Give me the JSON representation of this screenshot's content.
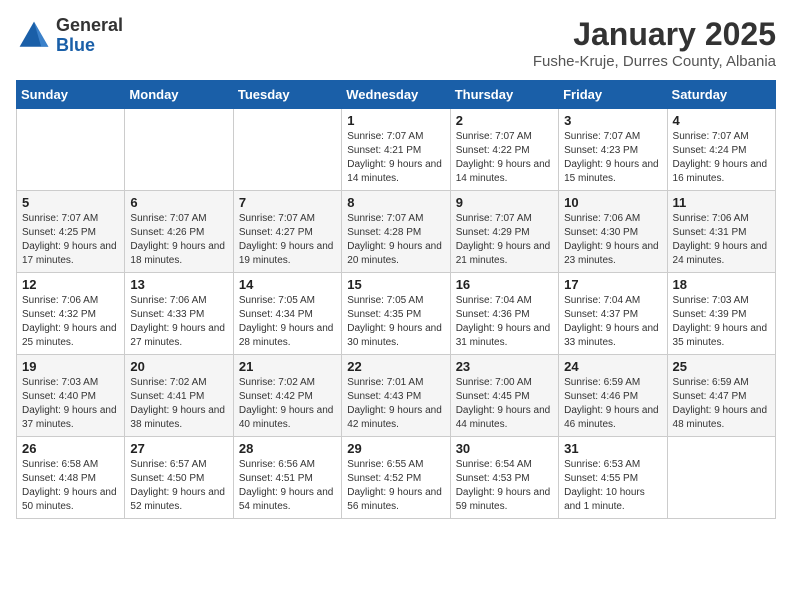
{
  "header": {
    "logo_general": "General",
    "logo_blue": "Blue",
    "month": "January 2025",
    "location": "Fushe-Kruje, Durres County, Albania"
  },
  "weekdays": [
    "Sunday",
    "Monday",
    "Tuesday",
    "Wednesday",
    "Thursday",
    "Friday",
    "Saturday"
  ],
  "weeks": [
    [
      {
        "day": "",
        "info": ""
      },
      {
        "day": "",
        "info": ""
      },
      {
        "day": "",
        "info": ""
      },
      {
        "day": "1",
        "info": "Sunrise: 7:07 AM\nSunset: 4:21 PM\nDaylight: 9 hours and 14 minutes."
      },
      {
        "day": "2",
        "info": "Sunrise: 7:07 AM\nSunset: 4:22 PM\nDaylight: 9 hours and 14 minutes."
      },
      {
        "day": "3",
        "info": "Sunrise: 7:07 AM\nSunset: 4:23 PM\nDaylight: 9 hours and 15 minutes."
      },
      {
        "day": "4",
        "info": "Sunrise: 7:07 AM\nSunset: 4:24 PM\nDaylight: 9 hours and 16 minutes."
      }
    ],
    [
      {
        "day": "5",
        "info": "Sunrise: 7:07 AM\nSunset: 4:25 PM\nDaylight: 9 hours and 17 minutes."
      },
      {
        "day": "6",
        "info": "Sunrise: 7:07 AM\nSunset: 4:26 PM\nDaylight: 9 hours and 18 minutes."
      },
      {
        "day": "7",
        "info": "Sunrise: 7:07 AM\nSunset: 4:27 PM\nDaylight: 9 hours and 19 minutes."
      },
      {
        "day": "8",
        "info": "Sunrise: 7:07 AM\nSunset: 4:28 PM\nDaylight: 9 hours and 20 minutes."
      },
      {
        "day": "9",
        "info": "Sunrise: 7:07 AM\nSunset: 4:29 PM\nDaylight: 9 hours and 21 minutes."
      },
      {
        "day": "10",
        "info": "Sunrise: 7:06 AM\nSunset: 4:30 PM\nDaylight: 9 hours and 23 minutes."
      },
      {
        "day": "11",
        "info": "Sunrise: 7:06 AM\nSunset: 4:31 PM\nDaylight: 9 hours and 24 minutes."
      }
    ],
    [
      {
        "day": "12",
        "info": "Sunrise: 7:06 AM\nSunset: 4:32 PM\nDaylight: 9 hours and 25 minutes."
      },
      {
        "day": "13",
        "info": "Sunrise: 7:06 AM\nSunset: 4:33 PM\nDaylight: 9 hours and 27 minutes."
      },
      {
        "day": "14",
        "info": "Sunrise: 7:05 AM\nSunset: 4:34 PM\nDaylight: 9 hours and 28 minutes."
      },
      {
        "day": "15",
        "info": "Sunrise: 7:05 AM\nSunset: 4:35 PM\nDaylight: 9 hours and 30 minutes."
      },
      {
        "day": "16",
        "info": "Sunrise: 7:04 AM\nSunset: 4:36 PM\nDaylight: 9 hours and 31 minutes."
      },
      {
        "day": "17",
        "info": "Sunrise: 7:04 AM\nSunset: 4:37 PM\nDaylight: 9 hours and 33 minutes."
      },
      {
        "day": "18",
        "info": "Sunrise: 7:03 AM\nSunset: 4:39 PM\nDaylight: 9 hours and 35 minutes."
      }
    ],
    [
      {
        "day": "19",
        "info": "Sunrise: 7:03 AM\nSunset: 4:40 PM\nDaylight: 9 hours and 37 minutes."
      },
      {
        "day": "20",
        "info": "Sunrise: 7:02 AM\nSunset: 4:41 PM\nDaylight: 9 hours and 38 minutes."
      },
      {
        "day": "21",
        "info": "Sunrise: 7:02 AM\nSunset: 4:42 PM\nDaylight: 9 hours and 40 minutes."
      },
      {
        "day": "22",
        "info": "Sunrise: 7:01 AM\nSunset: 4:43 PM\nDaylight: 9 hours and 42 minutes."
      },
      {
        "day": "23",
        "info": "Sunrise: 7:00 AM\nSunset: 4:45 PM\nDaylight: 9 hours and 44 minutes."
      },
      {
        "day": "24",
        "info": "Sunrise: 6:59 AM\nSunset: 4:46 PM\nDaylight: 9 hours and 46 minutes."
      },
      {
        "day": "25",
        "info": "Sunrise: 6:59 AM\nSunset: 4:47 PM\nDaylight: 9 hours and 48 minutes."
      }
    ],
    [
      {
        "day": "26",
        "info": "Sunrise: 6:58 AM\nSunset: 4:48 PM\nDaylight: 9 hours and 50 minutes."
      },
      {
        "day": "27",
        "info": "Sunrise: 6:57 AM\nSunset: 4:50 PM\nDaylight: 9 hours and 52 minutes."
      },
      {
        "day": "28",
        "info": "Sunrise: 6:56 AM\nSunset: 4:51 PM\nDaylight: 9 hours and 54 minutes."
      },
      {
        "day": "29",
        "info": "Sunrise: 6:55 AM\nSunset: 4:52 PM\nDaylight: 9 hours and 56 minutes."
      },
      {
        "day": "30",
        "info": "Sunrise: 6:54 AM\nSunset: 4:53 PM\nDaylight: 9 hours and 59 minutes."
      },
      {
        "day": "31",
        "info": "Sunrise: 6:53 AM\nSunset: 4:55 PM\nDaylight: 10 hours and 1 minute."
      },
      {
        "day": "",
        "info": ""
      }
    ]
  ]
}
